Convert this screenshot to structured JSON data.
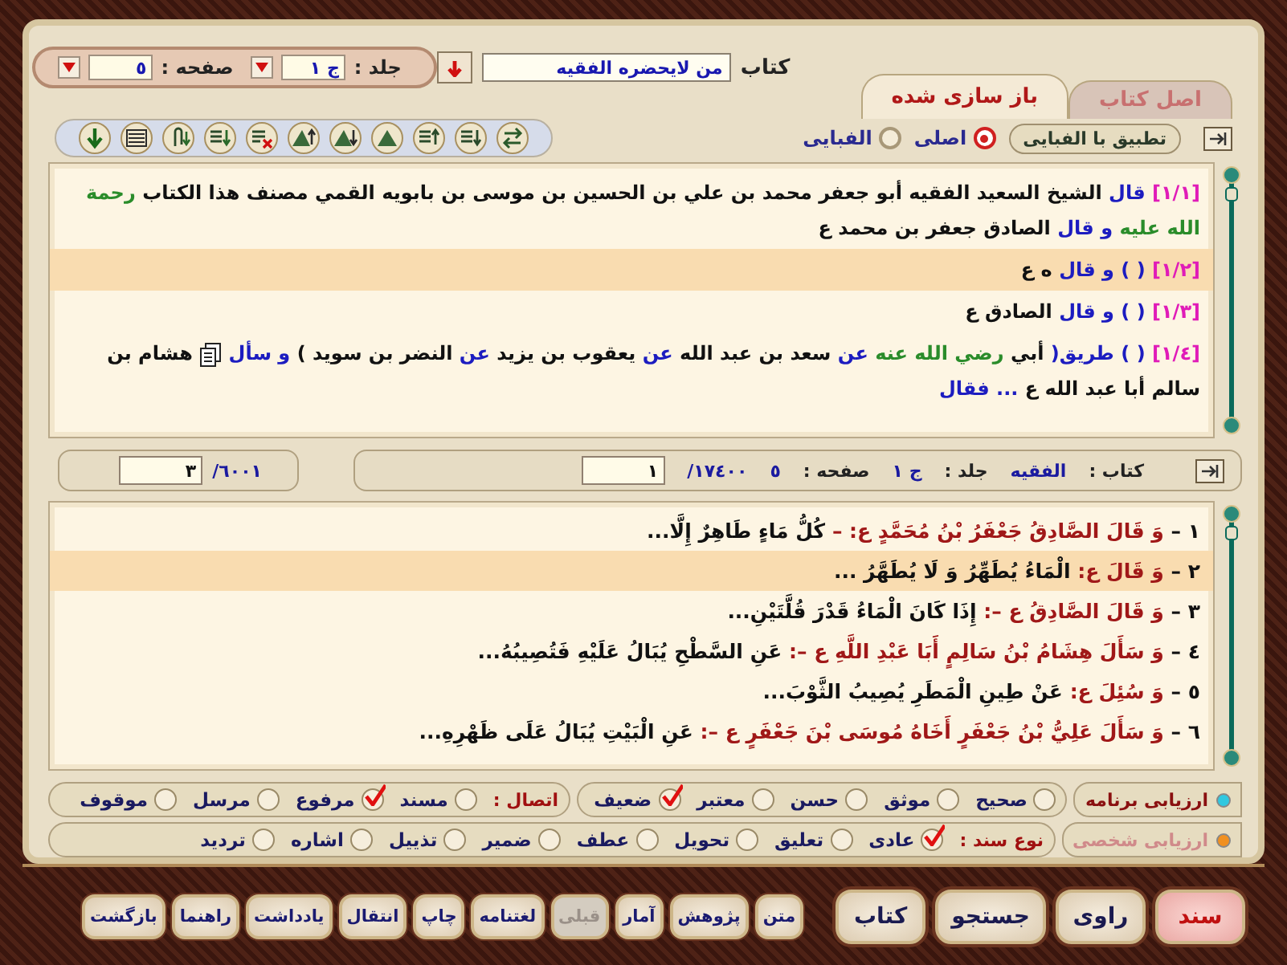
{
  "book_bar": {
    "book_label": "كتاب",
    "book_value": "من لايحضره الفقيه",
    "volume_label": "جلد :",
    "volume_value": "ج ١",
    "page_label": "صفحه :",
    "page_value": "٥"
  },
  "tabs": [
    {
      "label": "اصل كتاب",
      "selected": false
    },
    {
      "label": "باز سازی شده",
      "selected": true
    }
  ],
  "view": {
    "apply_button": "تطبيق با الفبايى",
    "options": [
      {
        "label": "اصلى",
        "selected": true
      },
      {
        "label": "الفبايى",
        "selected": false
      }
    ]
  },
  "upper_text": {
    "lines": [
      {
        "selected": false,
        "segments": [
          {
            "kind": "ref",
            "text": "[١/١]"
          },
          {
            "kind": "keyword",
            "text": "قال"
          },
          {
            "kind": "plain",
            "text": "الشيخ السعيد الفقيه أبو جعفر محمد بن علي بن الحسين بن موسى بن بابويه القمي مصنف هذا الكتاب"
          },
          {
            "kind": "honorific",
            "text": "رحمة الله عليه"
          },
          {
            "kind": "keyword",
            "text": "و"
          },
          {
            "kind": "keyword",
            "text": "قال"
          },
          {
            "kind": "plain",
            "text": "الصادق جعفر بن محمد ع"
          }
        ]
      },
      {
        "selected": true,
        "segments": [
          {
            "kind": "ref",
            "text": "[١/٢]"
          },
          {
            "kind": "keyword",
            "text": "( ) و قال"
          },
          {
            "kind": "plain",
            "text": "ه ع"
          }
        ]
      },
      {
        "selected": false,
        "segments": [
          {
            "kind": "ref",
            "text": "[١/٣]"
          },
          {
            "kind": "keyword",
            "text": "( ) و قال"
          },
          {
            "kind": "plain",
            "text": "الصادق ع"
          }
        ]
      },
      {
        "selected": false,
        "segments": [
          {
            "kind": "ref",
            "text": "[١/٤]"
          },
          {
            "kind": "keyword",
            "text": "( ) طريق("
          },
          {
            "kind": "plain",
            "text": "أبي"
          },
          {
            "kind": "honorific",
            "text": "رضي الله عنه"
          },
          {
            "kind": "keyword",
            "text": "عن"
          },
          {
            "kind": "plain",
            "text": "سعد بن عبد الله"
          },
          {
            "kind": "keyword",
            "text": "عن"
          },
          {
            "kind": "plain",
            "text": "يعقوب بن يزيد"
          },
          {
            "kind": "keyword",
            "text": "عن"
          },
          {
            "kind": "plain",
            "text": "النضر بن سويد )"
          },
          {
            "kind": "keyword",
            "text": "و سأل"
          },
          {
            "kind": "note"
          },
          {
            "kind": "plain",
            "text": "هشام بن سالم أبا عبد الله ع"
          },
          {
            "kind": "keyword",
            "text": "... فقال"
          }
        ]
      }
    ]
  },
  "location_bar": {
    "book_label": "كتاب :",
    "book_value": "الفقيه",
    "volume_label": "جلد :",
    "volume_value": "ج ١",
    "page_label": "صفحه :",
    "page_value": "٥",
    "total": "١٧٤٠٠/",
    "current": "١",
    "line_total": "٦٠٠١/",
    "line_current": "٣"
  },
  "lower_text": {
    "lines": [
      {
        "selected": false,
        "segments": [
          {
            "kind": "num",
            "text": "١ –"
          },
          {
            "kind": "chain",
            "text": "وَ قَالَ الصَّادِقُ جَعْفَرُ بْنُ مُحَمَّدٍ ع: –"
          },
          {
            "kind": "matn",
            "text": "كُلُّ مَاءٍ طَاهِرٌ إِلَّا..."
          }
        ]
      },
      {
        "selected": true,
        "segments": [
          {
            "kind": "num",
            "text": "٢ –"
          },
          {
            "kind": "chain",
            "text": "وَ قَالَ ع:"
          },
          {
            "kind": "matn",
            "text": "الْمَاءُ يُطَهِّرُ وَ لَا يُطَهَّرُ ..."
          }
        ]
      },
      {
        "selected": false,
        "segments": [
          {
            "kind": "num",
            "text": "٣ –"
          },
          {
            "kind": "chain",
            "text": "وَ قَالَ الصَّادِقُ ع –:"
          },
          {
            "kind": "matn",
            "text": "إِذَا كَانَ الْمَاءُ قَدْرَ قُلَّتَيْنِ..."
          }
        ]
      },
      {
        "selected": false,
        "segments": [
          {
            "kind": "num",
            "text": "٤ –"
          },
          {
            "kind": "chain",
            "text": "وَ سَأَلَ هِشَامُ بْنُ سَالِمٍ أَبَا عَبْدِ اللَّهِ ع –:"
          },
          {
            "kind": "matn",
            "text": "عَنِ السَّطْحِ يُبَالُ عَلَيْهِ فَتُصِيبُهُ..."
          }
        ]
      },
      {
        "selected": false,
        "segments": [
          {
            "kind": "num",
            "text": "٥ –"
          },
          {
            "kind": "chain",
            "text": "وَ سُئِلَ ع:"
          },
          {
            "kind": "matn",
            "text": "عَنْ طِينِ الْمَطَرِ يُصِيبُ الثَّوْبَ..."
          }
        ]
      },
      {
        "selected": false,
        "segments": [
          {
            "kind": "num",
            "text": "٦ –"
          },
          {
            "kind": "chain",
            "text": "وَ سَأَلَ عَلِيُّ بْنُ جَعْفَرٍ أَخَاهُ مُوسَى بْنَ جَعْفَرٍ ع –:"
          },
          {
            "kind": "matn",
            "text": "عَنِ الْبَيْتِ يُبَالُ عَلَى ظَهْرِهِ..."
          }
        ]
      }
    ]
  },
  "evaluation": [
    {
      "label": "ارزيابى برنامه",
      "selected": true,
      "groups": [
        {
          "options": [
            {
              "label": "صحيح",
              "checked": false
            },
            {
              "label": "موثق",
              "checked": false
            },
            {
              "label": "حسن",
              "checked": false
            },
            {
              "label": "معتبر",
              "checked": false
            },
            {
              "label": "ضعيف",
              "checked": true
            }
          ]
        },
        {
          "title": "اتصال :",
          "options": [
            {
              "label": "مسند",
              "checked": false
            },
            {
              "label": "مرفوع",
              "checked": true
            },
            {
              "label": "مرسل",
              "checked": false
            },
            {
              "label": "موقوف",
              "checked": false
            }
          ]
        }
      ]
    },
    {
      "label": "ارزيابى شخصى",
      "selected": false,
      "groups": [
        {
          "title": "نوع سند :",
          "options": [
            {
              "label": "عادى",
              "checked": true
            },
            {
              "label": "تعليق",
              "checked": false
            },
            {
              "label": "تحويل",
              "checked": false
            },
            {
              "label": "عطف",
              "checked": false
            },
            {
              "label": "ضمير",
              "checked": false
            },
            {
              "label": "تذييل",
              "checked": false
            },
            {
              "label": "اشاره",
              "checked": false
            },
            {
              "label": "ترديد",
              "checked": false
            }
          ]
        }
      ]
    }
  ],
  "main_buttons": [
    {
      "label": "سند",
      "selected": true
    },
    {
      "label": "راوی",
      "selected": false
    },
    {
      "label": "جستجو",
      "selected": false
    },
    {
      "label": "كتاب",
      "selected": false
    }
  ],
  "tool_buttons": [
    {
      "label": "متن",
      "disabled": false
    },
    {
      "label": "پژوهش",
      "disabled": false
    },
    {
      "label": "آمار",
      "disabled": false
    },
    {
      "label": "قبلى",
      "disabled": true
    },
    {
      "label": "لغتنامه",
      "disabled": false
    },
    {
      "label": "چاپ",
      "disabled": false
    },
    {
      "label": "انتقال",
      "disabled": false
    },
    {
      "label": "يادداشت",
      "disabled": false
    },
    {
      "label": "راهنما",
      "disabled": false
    },
    {
      "label": "بازگشت",
      "disabled": false
    }
  ]
}
